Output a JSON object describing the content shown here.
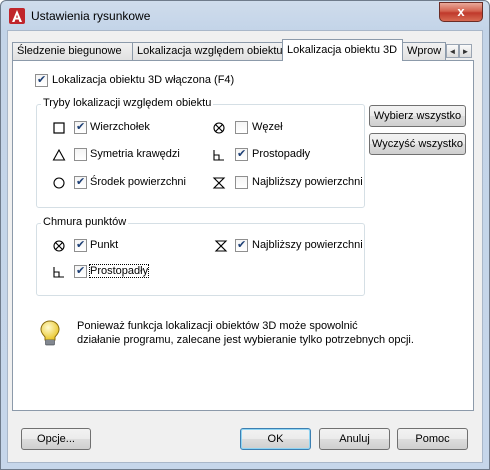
{
  "window": {
    "title": "Ustawienia rysunkowe",
    "close_label": "x"
  },
  "tabs": [
    {
      "label": "Śledzenie biegunowe"
    },
    {
      "label": "Lokalizacja względem obiektu"
    },
    {
      "label": "Lokalizacja obiektu 3D"
    },
    {
      "label": "Wprow"
    }
  ],
  "tab_scroll": {
    "left": "◄",
    "right": "►"
  },
  "osnap3d_enabled": {
    "label": "Lokalizacja obiektu 3D włączona (F4)",
    "checked": true
  },
  "modes_group": {
    "title": "Tryby lokalizacji względem obiektu",
    "items": [
      {
        "label": "Wierzchołek",
        "checked": true,
        "icon": "square-icon"
      },
      {
        "label": "Symetria krawędzi",
        "checked": false,
        "icon": "triangle-icon"
      },
      {
        "label": "Środek powierzchni",
        "checked": true,
        "icon": "circle-icon"
      },
      {
        "label": "Węzeł",
        "checked": false,
        "icon": "node-icon"
      },
      {
        "label": "Prostopadły",
        "checked": true,
        "icon": "perpendicular-icon"
      },
      {
        "label": "Najbliższy powierzchni",
        "checked": false,
        "icon": "nearest-icon"
      }
    ]
  },
  "buttons_side": {
    "select_all": "Wybierz wszystko",
    "clear_all": "Wyczyść wszystko"
  },
  "pointcloud_group": {
    "title": "Chmura punktów",
    "items": [
      {
        "label": "Punkt",
        "checked": true,
        "icon": "node-icon"
      },
      {
        "label": "Prostopadły",
        "checked": true,
        "icon": "perpendicular-icon"
      },
      {
        "label": "Najbliższy powierzchni",
        "checked": true,
        "icon": "nearest-icon"
      }
    ]
  },
  "info": {
    "text_line1": "Ponieważ funkcja lokalizacji obiektów 3D może spowolnić",
    "text_line2": "działanie programu, zalecane jest wybieranie tylko potrzebnych opcji."
  },
  "footer": {
    "options": "Opcje...",
    "ok": "OK",
    "cancel": "Anuluj",
    "help": "Pomoc"
  },
  "colors": {
    "accent": "#3c7fb1",
    "checkmark": "#1d3f75",
    "close": "#c0392b"
  }
}
